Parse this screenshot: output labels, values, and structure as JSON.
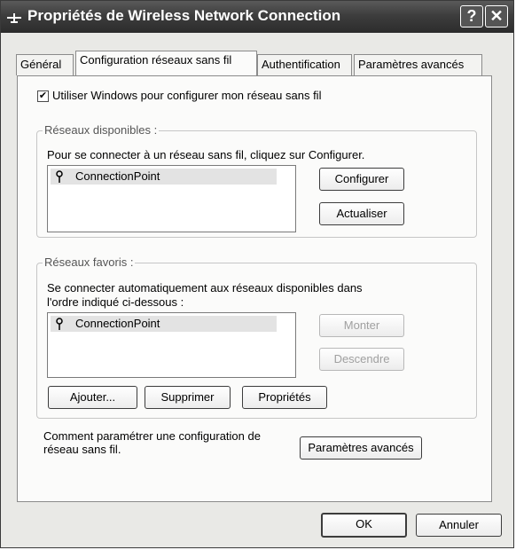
{
  "window": {
    "title": "Propriétés de Wireless Network Connection",
    "help_label": "?",
    "close_label": "✕"
  },
  "tabs": [
    {
      "label": "Général",
      "active": false
    },
    {
      "label": "Configuration réseaux sans fil",
      "active": true
    },
    {
      "label": "Authentification",
      "active": false
    },
    {
      "label": "Paramètres avancés",
      "active": false
    }
  ],
  "use_windows": {
    "checked": true,
    "label": "Utiliser Windows pour configurer mon réseau sans fil"
  },
  "available": {
    "title": "Réseaux disponibles :",
    "description": "Pour se connecter à un réseau sans fil, cliquez sur Configurer.",
    "items": [
      "ConnectionPoint"
    ],
    "configure_label": "Configurer",
    "refresh_label": "Actualiser"
  },
  "preferred": {
    "title": "Réseaux favoris :",
    "description_line1": "Se connecter automatiquement aux réseaux disponibles dans",
    "description_line2": "l'ordre indiqué ci-dessous :",
    "items": [
      "ConnectionPoint"
    ],
    "up_label": "Monter",
    "down_label": "Descendre",
    "add_label": "Ajouter...",
    "remove_label": "Supprimer",
    "properties_label": "Propriétés"
  },
  "help_link": {
    "line1": "Comment paramétrer une configuration de",
    "line2": "réseau sans fil."
  },
  "advanced_label": "Paramètres avancés",
  "footer": {
    "ok_label": "OK",
    "cancel_label": "Annuler"
  }
}
